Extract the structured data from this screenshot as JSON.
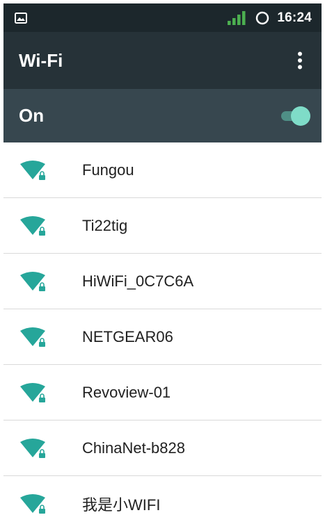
{
  "status_bar": {
    "time": "16:24",
    "notification_icon": "image-icon",
    "signal_icon": "signal-bars-icon",
    "sync_icon": "circle-icon"
  },
  "toolbar": {
    "title": "Wi-Fi",
    "menu_icon": "overflow-menu-icon"
  },
  "wifi_toggle": {
    "label": "On",
    "state": true
  },
  "networks": [
    {
      "name": "Fungou",
      "secured": true
    },
    {
      "name": "Ti22tig",
      "secured": true
    },
    {
      "name": "HiWiFi_0C7C6A",
      "secured": true
    },
    {
      "name": "NETGEAR06",
      "secured": true
    },
    {
      "name": "Revoview-01",
      "secured": true
    },
    {
      "name": "ChinaNet-b828",
      "secured": true
    },
    {
      "name": "我是小WIFI",
      "secured": true
    }
  ],
  "colors": {
    "status_bar": "#1c272c",
    "toolbar": "#263238",
    "toggle_row": "#37474f",
    "accent": "#26a69a",
    "toggle_thumb": "#7fdcc8",
    "signal_green": "#4caf50"
  }
}
